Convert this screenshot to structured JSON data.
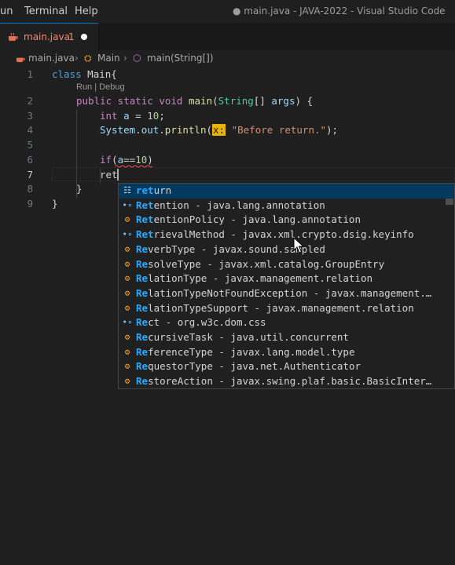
{
  "menu": [
    "un",
    "Terminal",
    "Help"
  ],
  "window_title": "● main.java - JAVA-2022 - Visual Studio Code",
  "tab": {
    "label": "main.java",
    "problem_count": "1"
  },
  "breadcrumb": {
    "file": "main.java",
    "class": "Main",
    "method": "main(String[])"
  },
  "codelens": "Run | Debug",
  "line_numbers": [
    "1",
    "2",
    "3",
    "4",
    "5",
    "6",
    "7",
    "8",
    "9"
  ],
  "code": {
    "l1": {
      "kw": "class",
      "name": " Main{"
    },
    "l2": {
      "mod": "public static void",
      "fn": "main",
      "p1": "(",
      "ty": "String",
      "p2": "[] ",
      "var": "args",
      "p3": ") {"
    },
    "l3": {
      "kw": "int",
      "var": " a",
      "eq": " = ",
      "num": "10",
      "semi": ";"
    },
    "l4": {
      "obj": "System",
      "d1": ".",
      "fld": "out",
      "d2": ".",
      "fn": "println",
      "p1": "(",
      "hint": "x:",
      "sp": " ",
      "str": "\"Before return.\"",
      "p2": ");"
    },
    "l6": {
      "kw": "if",
      "p1": "(",
      "var": "a",
      "op": "==",
      "num": "10",
      "p2": ")"
    },
    "l7": {
      "text": "ret"
    },
    "l8": {
      "text": "}"
    },
    "l9": {
      "text": "}"
    }
  },
  "suggestions": [
    {
      "icon": "keyword",
      "match": "ret",
      "rest": "urn",
      "detail": ""
    },
    {
      "icon": "interface",
      "match": "Ret",
      "rest": "ention",
      "detail": " - java.lang.annotation"
    },
    {
      "icon": "class",
      "match": "Ret",
      "rest": "entionPolicy",
      "detail": " - java.lang.annotation"
    },
    {
      "icon": "interface",
      "match": "Ret",
      "rest": "rievalMethod",
      "detail": " - javax.xml.crypto.dsig.keyinfo"
    },
    {
      "icon": "class",
      "match": "Re",
      "rest": "verbType",
      "detail": " - javax.sound.sampled"
    },
    {
      "icon": "class",
      "match": "Re",
      "rest": "solveType",
      "detail": " - javax.xml.catalog.GroupEntry"
    },
    {
      "icon": "class",
      "match": "Re",
      "rest": "lationType",
      "detail": " - javax.management.relation"
    },
    {
      "icon": "class",
      "match": "Re",
      "rest": "lationTypeNotFoundException",
      "detail": " - javax.management.…"
    },
    {
      "icon": "class",
      "match": "Re",
      "rest": "lationTypeSupport",
      "detail": " - javax.management.relation"
    },
    {
      "icon": "interface",
      "match": "Re",
      "rest": "ct",
      "detail": " - org.w3c.dom.css"
    },
    {
      "icon": "class",
      "match": "Re",
      "rest": "cursiveTask",
      "detail": " - java.util.concurrent"
    },
    {
      "icon": "class",
      "match": "Re",
      "rest": "ferenceType",
      "detail": " - javax.lang.model.type"
    },
    {
      "icon": "class",
      "match": "Re",
      "rest": "questorType",
      "detail": " - java.net.Authenticator"
    },
    {
      "icon": "class",
      "match": "Re",
      "rest": "storeAction",
      "detail": " - javax.swing.plaf.basic.BasicInter…"
    }
  ]
}
